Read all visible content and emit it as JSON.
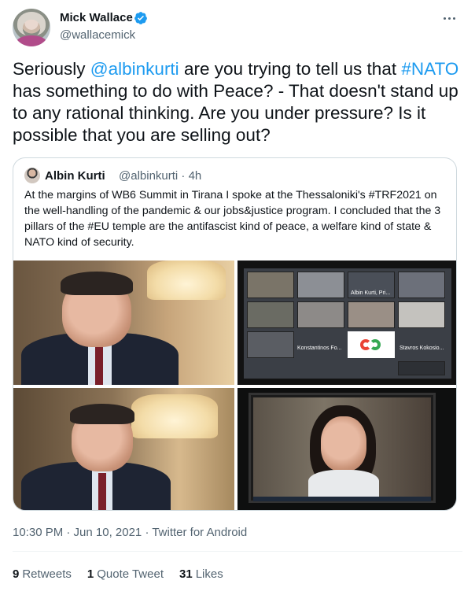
{
  "author": {
    "name": "Mick Wallace",
    "handle": "@wallacemick",
    "verified": true
  },
  "tweet": {
    "segments": [
      {
        "text": "Seriously ",
        "type": "text"
      },
      {
        "text": "@albinkurti",
        "type": "link"
      },
      {
        "text": " are you trying to tell us that ",
        "type": "text"
      },
      {
        "text": "#NATO",
        "type": "link"
      },
      {
        "text": " has something to do with Peace? - That doesn't stand up to any rational thinking. Are you under pressure? Is it possible that you are selling out?",
        "type": "text"
      }
    ]
  },
  "quote": {
    "name": "Albin Kurti",
    "meta": "@albinkurti · 4h",
    "text": "At the margins of WB6 Summit in Tirana I spoke at the Thessaloniki's #TRF2021 on the well-handling of the pandemic & our jobs&justice program. I concluded that the 3 pillars of the #EU temple are the antifascist kind of peace, a welfare kind of state & NATO kind of security.",
    "video_labels": [
      "Albin Kurti, Pri...",
      "Konstantinos Fo...",
      "Stavros Kokosio..."
    ]
  },
  "footer": {
    "timestamp": "10:30 PM · Jun 10, 2021 · Twitter for Android",
    "retweets_count": "9",
    "retweets_label": "Retweets",
    "quotes_count": "1",
    "quotes_label": "Quote Tweet",
    "likes_count": "31",
    "likes_label": "Likes"
  },
  "colors": {
    "link": "#1d9bf0",
    "secondary_text": "#536471",
    "border": "#cfd9de"
  },
  "icons": [
    "verified-icon",
    "more-icon"
  ]
}
